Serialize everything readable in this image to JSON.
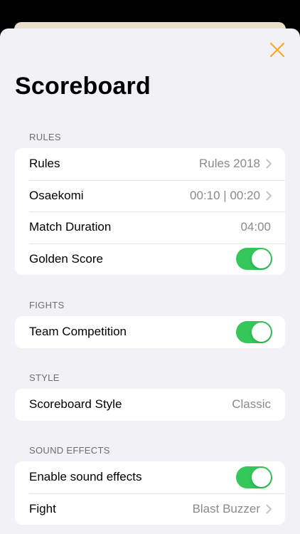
{
  "header": {
    "title": "Scoreboard"
  },
  "colors": {
    "accent": "#f5a623",
    "toggle_on": "#34c759",
    "secondary_text": "#8a8a8e"
  },
  "sections": {
    "rules": {
      "header": "RULES",
      "rows": [
        {
          "label": "Rules",
          "value": "Rules 2018"
        },
        {
          "label": "Osaekomi",
          "value": "00:10 | 00:20"
        },
        {
          "label": "Match Duration",
          "value": "04:00"
        },
        {
          "label": "Golden Score",
          "toggle": true
        }
      ]
    },
    "fights": {
      "header": "FIGHTS",
      "rows": [
        {
          "label": "Team Competition",
          "toggle": true
        }
      ]
    },
    "style": {
      "header": "STYLE",
      "rows": [
        {
          "label": "Scoreboard Style",
          "value": "Classic"
        }
      ]
    },
    "sound": {
      "header": "SOUND EFFECTS",
      "rows": [
        {
          "label": "Enable sound effects",
          "toggle": true
        },
        {
          "label": "Fight",
          "value": "Blast Buzzer"
        }
      ]
    }
  }
}
